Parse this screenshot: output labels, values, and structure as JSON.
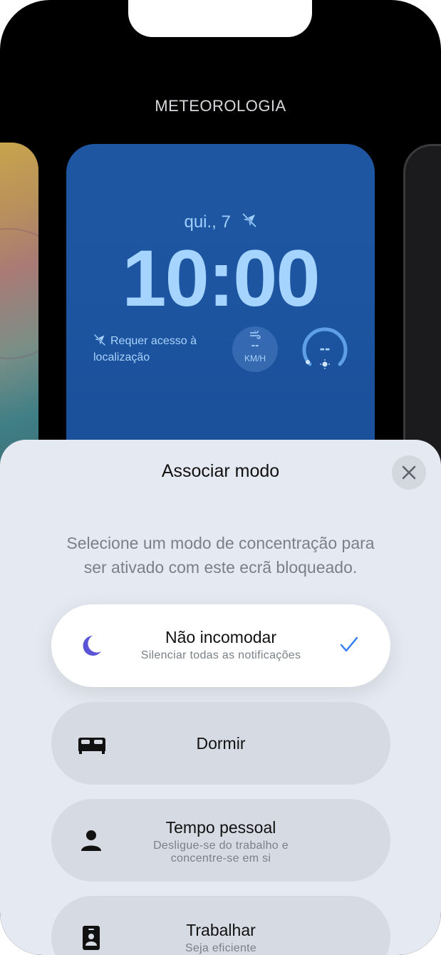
{
  "header": {
    "title": "METEOROLOGIA"
  },
  "lockscreen": {
    "date": "qui., 7",
    "time": "10:00",
    "location_text_line1": "Requer acesso à",
    "location_text_line2": "localização",
    "wind_value": "--",
    "wind_unit": "KM/H",
    "uv_value": "--",
    "accent_color": "#a4d4ff",
    "background_color": "#1f56a2"
  },
  "sheet": {
    "title": "Associar modo",
    "close_icon": "close-icon",
    "description_line1": "Selecione um modo de concentração para",
    "description_line2": "ser ativado com este ecrã bloqueado.",
    "options": [
      {
        "title": "Não incomodar",
        "subtitle": "Silenciar todas as notificações",
        "icon": "moon-icon",
        "selected": true
      },
      {
        "title": "Dormir",
        "subtitle": "",
        "icon": "bed-icon",
        "selected": false
      },
      {
        "title": "Tempo pessoal",
        "subtitle_line1": "Desligue-se do trabalho e",
        "subtitle_line2": "concentre-se em si",
        "icon": "person-icon",
        "selected": false
      },
      {
        "title": "Trabalhar",
        "subtitle": "Seja eficiente",
        "icon": "id-badge-icon",
        "selected": false
      }
    ],
    "check_color": "#2f7cf6",
    "moon_color": "#5a55d6"
  }
}
